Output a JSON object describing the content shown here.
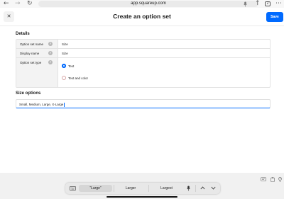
{
  "browser": {
    "back_icon": "←",
    "forward_icon": "→",
    "reload_icon": "↻",
    "url": "app.squareup.com",
    "mic_icon": "mic-icon",
    "share_icon": "↑",
    "tab_count": "2",
    "menu_icon": "⋯"
  },
  "header": {
    "close_icon": "✕",
    "title": "Create an option set",
    "save_label": "Save"
  },
  "details": {
    "heading": "Details",
    "rows": [
      {
        "label": "Option set name",
        "value": "Size"
      },
      {
        "label": "Display name",
        "value": "Size"
      },
      {
        "label": "Option set type"
      }
    ],
    "info_glyph": "?",
    "type_options": [
      {
        "label": "Text",
        "selected": true
      },
      {
        "label": "Text and color",
        "selected": false
      }
    ]
  },
  "size_options": {
    "heading": "Size options",
    "value": "Small, Medium, Large, X-Large"
  },
  "keyboard": {
    "suggestions": [
      "“Large”",
      "Larger",
      "Largest"
    ],
    "up_icon": "▲",
    "down_icon": "▼",
    "keyboard_icon": "⌨",
    "mic_icon": "🎙"
  },
  "colors": {
    "accent": "#006aff",
    "label_bg": "#f3f3f3"
  }
}
